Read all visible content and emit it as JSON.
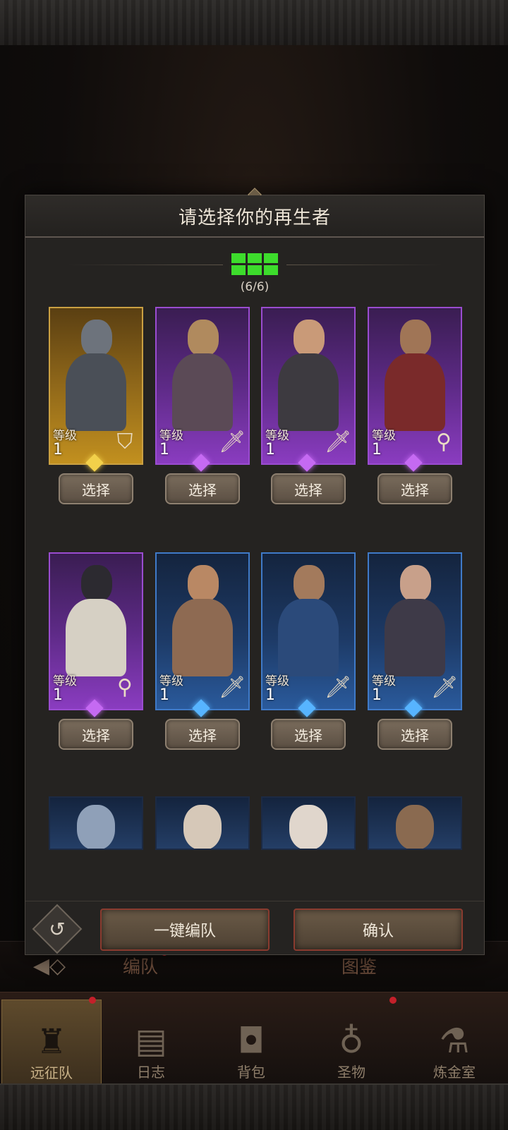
{
  "dialog": {
    "title": "请选择你的再生者",
    "team_count": "(6/6)",
    "select_label": "选择",
    "level_label": "等级",
    "auto_team_label": "一键编队",
    "confirm_label": "确认"
  },
  "heroes": [
    {
      "level": "1",
      "rarity": "gold",
      "role_icon": "shield-icon"
    },
    {
      "level": "1",
      "rarity": "purple",
      "role_icon": "sword-icon"
    },
    {
      "level": "1",
      "rarity": "purple",
      "role_icon": "sword-icon"
    },
    {
      "level": "1",
      "rarity": "purple",
      "role_icon": "staff-icon"
    },
    {
      "level": "1",
      "rarity": "purple",
      "role_icon": "staff-icon"
    },
    {
      "level": "1",
      "rarity": "blue",
      "role_icon": "sword-icon"
    },
    {
      "level": "1",
      "rarity": "blue",
      "role_icon": "sword-icon"
    },
    {
      "level": "1",
      "rarity": "blue",
      "role_icon": "sword-icon"
    }
  ],
  "background_tabs": {
    "formation": "编队",
    "codex": "图鉴"
  },
  "bottom_nav": [
    {
      "label": "远征队",
      "icon": "helmet-icon",
      "active": true
    },
    {
      "label": "日志",
      "icon": "scroll-icon",
      "active": false
    },
    {
      "label": "背包",
      "icon": "bag-icon",
      "active": false
    },
    {
      "label": "圣物",
      "icon": "relic-icon",
      "active": false
    },
    {
      "label": "炼金室",
      "icon": "alchemy-icon",
      "active": false
    }
  ],
  "colors": {
    "gold": "#caa042",
    "purple": "#9a4cd0",
    "blue": "#3f7ac8",
    "team_green": "#3ddc2c",
    "button_border_red": "#8a3b2f"
  }
}
